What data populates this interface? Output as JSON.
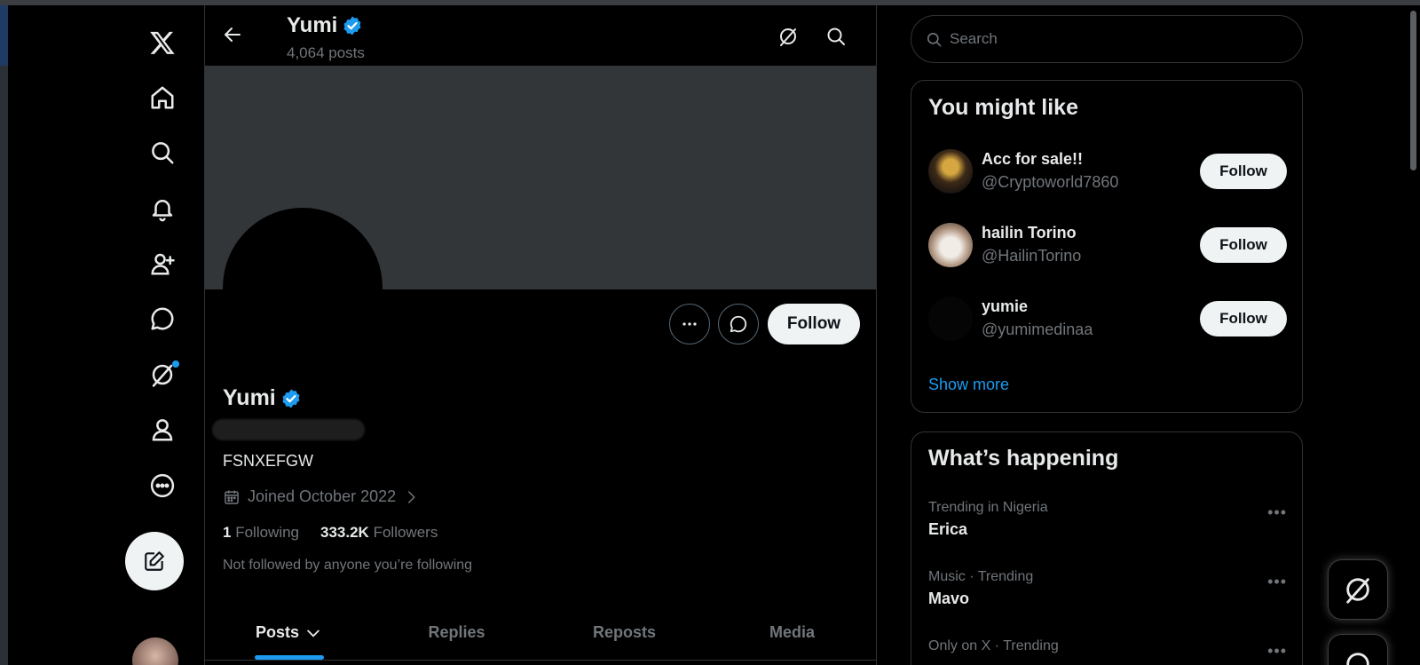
{
  "nav": {
    "items": [
      {
        "name": "x-logo-icon"
      },
      {
        "name": "home-icon"
      },
      {
        "name": "explore-icon"
      },
      {
        "name": "notifications-icon"
      },
      {
        "name": "follow-icon"
      },
      {
        "name": "messages-icon"
      },
      {
        "name": "grok-icon"
      },
      {
        "name": "profile-icon"
      },
      {
        "name": "more-icon"
      }
    ],
    "compose_icon": "compose-icon"
  },
  "header": {
    "title": "Yumi",
    "posts_count": "4,064 posts"
  },
  "profile": {
    "display_name": "Yumi",
    "bio": "FSNXEFGW",
    "joined": "Joined October 2022",
    "following_count": "1",
    "following_label": "Following",
    "followers_count": "333.2K",
    "followers_label": "Followers",
    "not_followed": "Not followed by anyone you’re following",
    "follow_label": "Follow"
  },
  "tabs": [
    {
      "label": "Posts",
      "active": true
    },
    {
      "label": "Replies",
      "active": false
    },
    {
      "label": "Reposts",
      "active": false
    },
    {
      "label": "Media",
      "active": false
    }
  ],
  "search": {
    "placeholder": "Search"
  },
  "you_might_like": {
    "title": "You might like",
    "suggestions": [
      {
        "name": "Acc for sale!!",
        "handle": "@Cryptoworld7860",
        "follow": "Follow"
      },
      {
        "name": "hailin Torino",
        "handle": "@HailinTorino",
        "follow": "Follow"
      },
      {
        "name": "yumie",
        "handle": "@yumimedinaa",
        "follow": "Follow"
      }
    ],
    "show_more": "Show more"
  },
  "whats_happening": {
    "title": "What’s happening",
    "trends": [
      {
        "context": "Trending in Nigeria",
        "topic": "Erica"
      },
      {
        "context": "Music · Trending",
        "topic": "Mavo"
      },
      {
        "context": "Only on X · Trending",
        "topic": ""
      }
    ]
  },
  "colors": {
    "accent": "#1d9bf0",
    "background": "#000000",
    "banner": "#333639",
    "muted": "#71767b"
  }
}
